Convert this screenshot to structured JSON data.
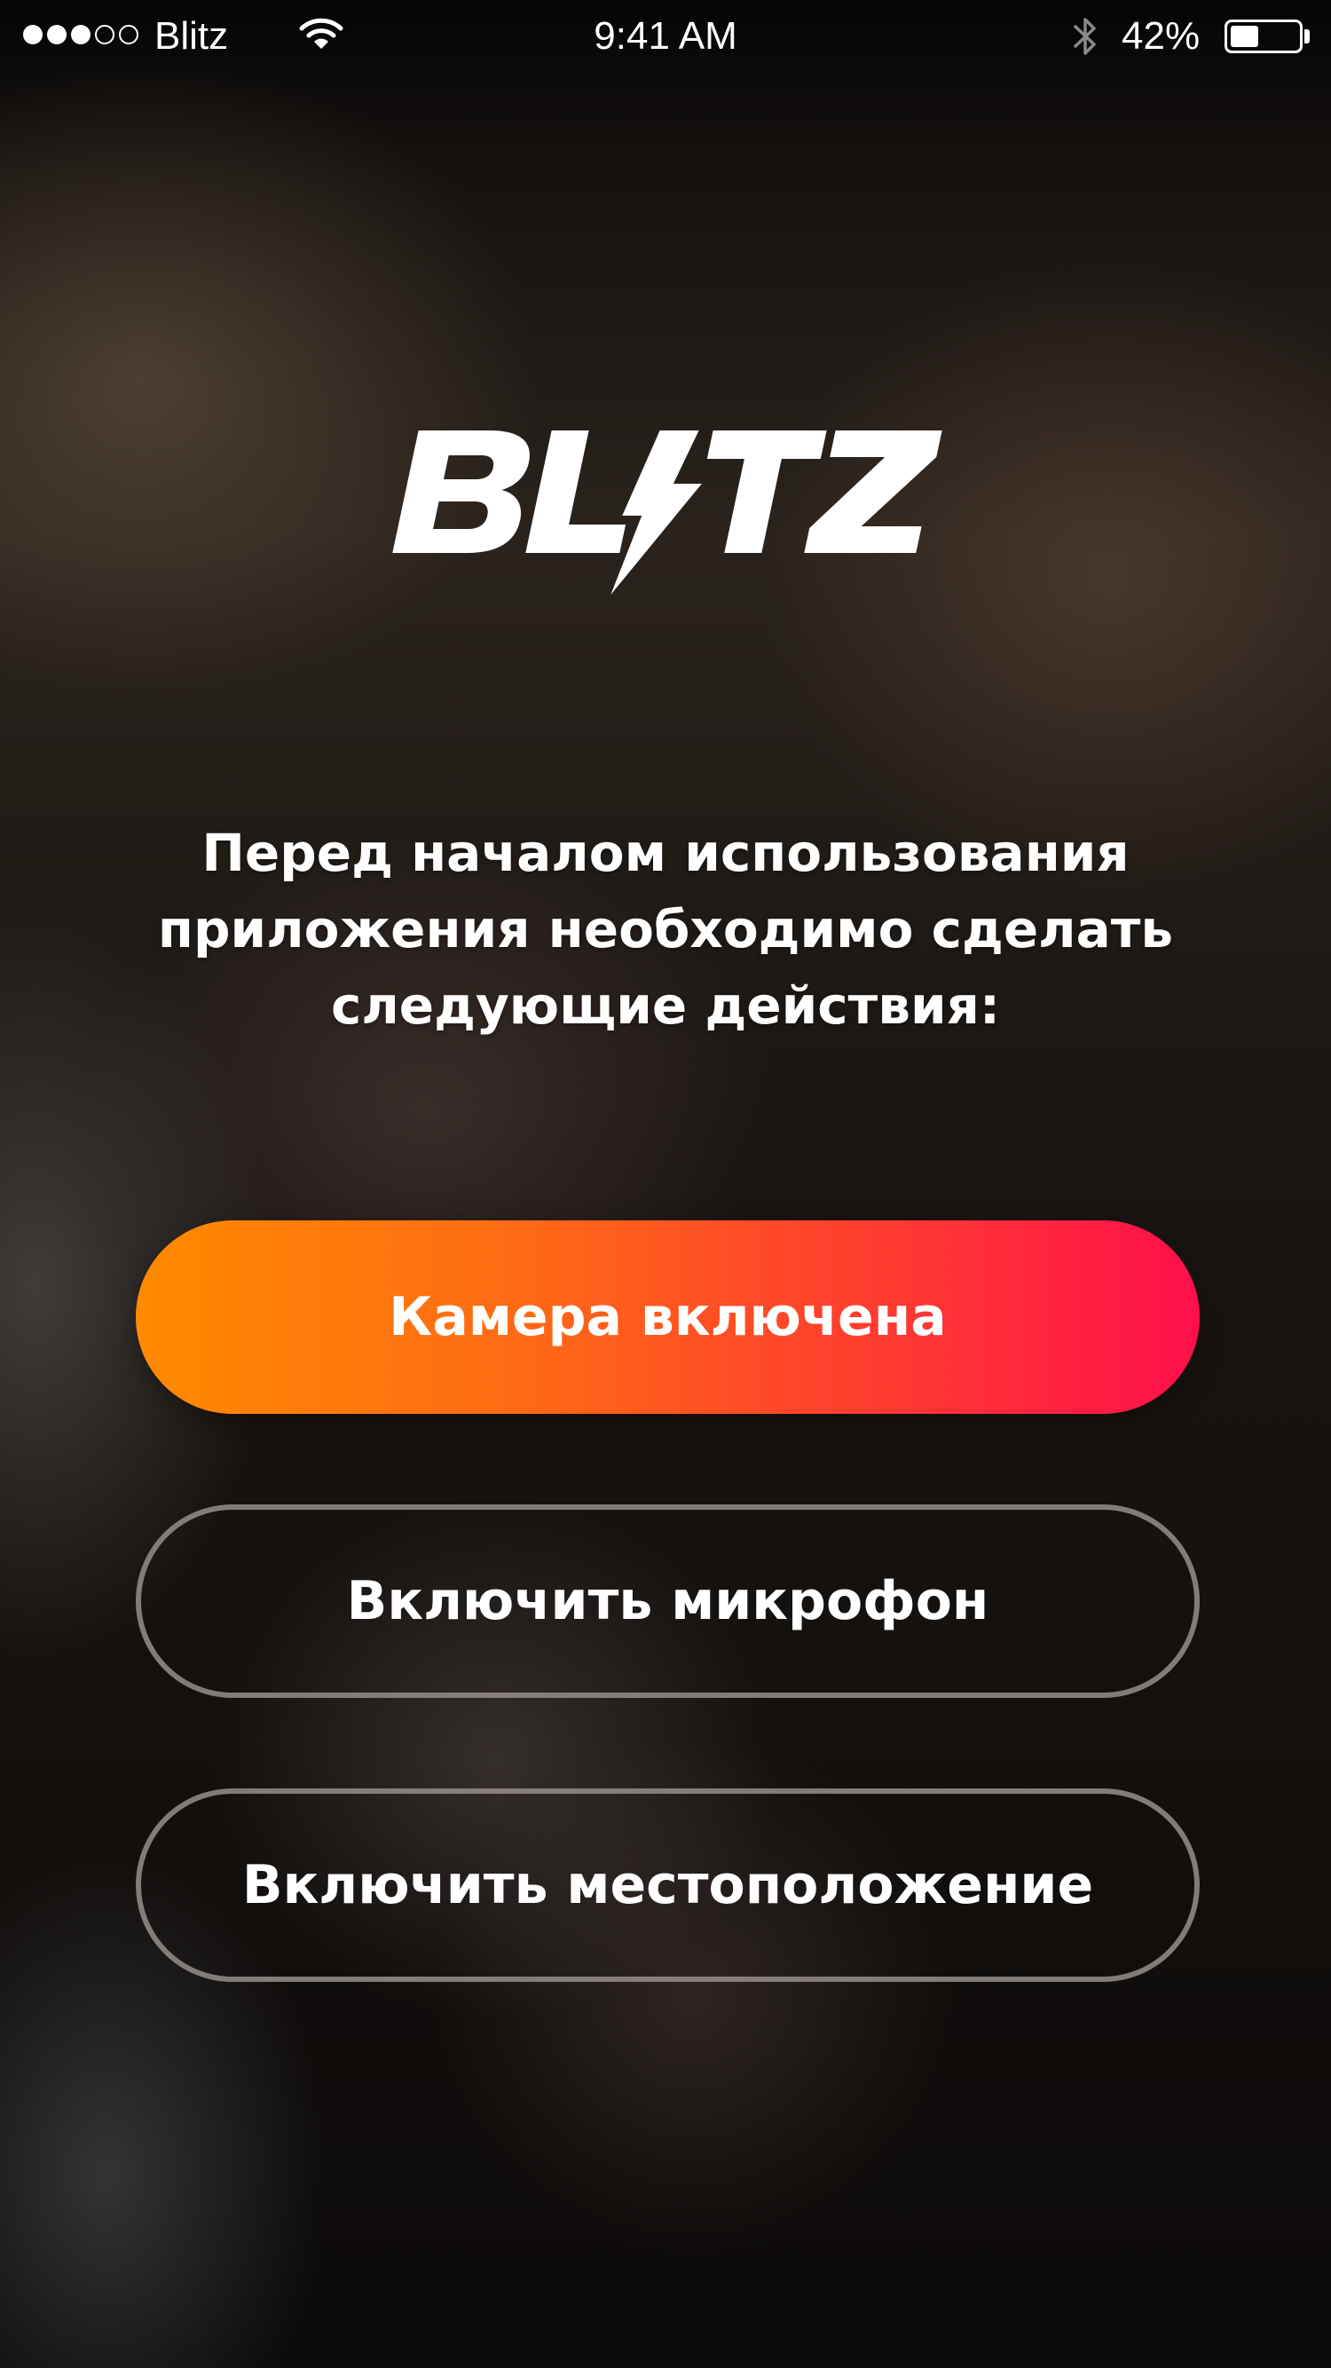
{
  "status_bar": {
    "signal": {
      "filled": 3,
      "total": 5
    },
    "carrier": "Blitz",
    "time": "9:41 AM",
    "battery_percent_label": "42%",
    "battery_level": 0.42,
    "icons": [
      "signal-dots-icon",
      "wifi-icon",
      "bluetooth-icon",
      "battery-icon"
    ]
  },
  "logo": {
    "text": "BLITZ",
    "color": "#ffffff"
  },
  "intro": {
    "text": "Перед началом использования приложения необходимо сделать следующие действия:"
  },
  "buttons": {
    "camera": {
      "label": "Камера включена",
      "style": "gradient",
      "gradient_colors": [
        "#ff8a00",
        "#ff0f4b"
      ]
    },
    "microphone": {
      "label": "Включить микрофон",
      "style": "outline"
    },
    "location": {
      "label": "Включить местоположение",
      "style": "outline"
    }
  }
}
